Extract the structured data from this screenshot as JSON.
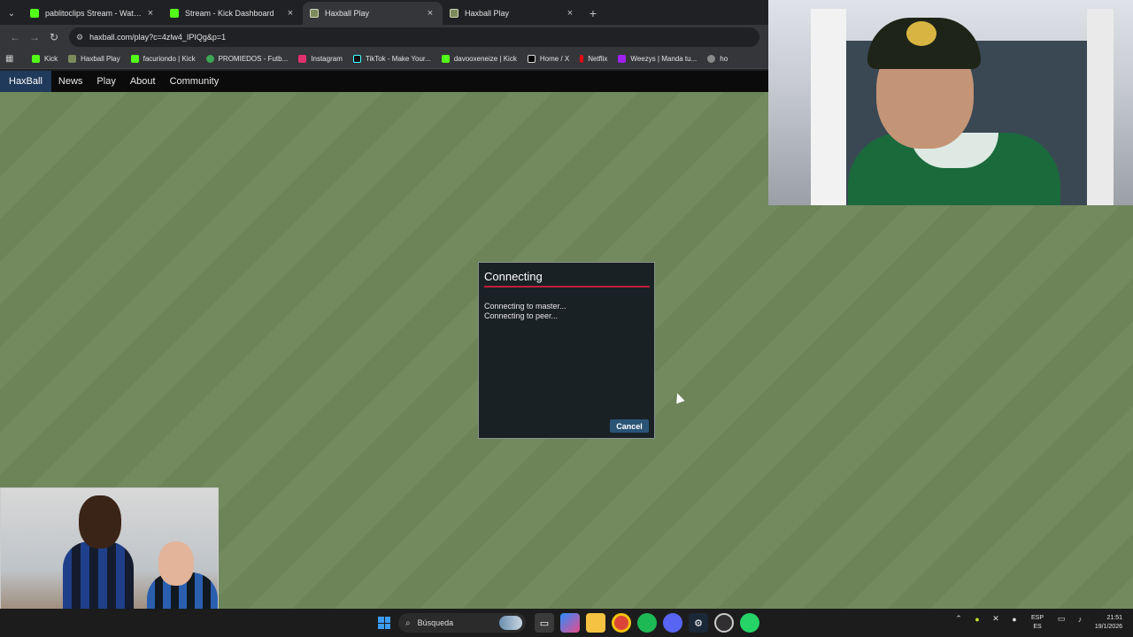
{
  "tabs": [
    {
      "title": "pablitoclips Stream - Watch Li...",
      "icon": "kick-icon",
      "active": false
    },
    {
      "title": "Stream - Kick Dashboard",
      "icon": "kick-icon",
      "active": false
    },
    {
      "title": "Haxball Play",
      "icon": "haxball-icon",
      "active": true
    },
    {
      "title": "Haxball Play",
      "icon": "haxball-icon",
      "active": false
    }
  ],
  "address_bar": {
    "url": "haxball.com/play?c=4zlw4_IPIQg&p=1"
  },
  "bookmarks": [
    {
      "label": "Kick",
      "color": "#53fc18"
    },
    {
      "label": "Haxball Play",
      "color": "#7c8a5c"
    },
    {
      "label": "facuriondo | Kick",
      "color": "#53fc18"
    },
    {
      "label": "PROMIEDOS - Futb...",
      "color": "#3aa655"
    },
    {
      "label": "Instagram",
      "color": "#e1306c"
    },
    {
      "label": "TikTok - Make Your...",
      "color": "#111111"
    },
    {
      "label": "davooxeneize | Kick",
      "color": "#53fc18"
    },
    {
      "label": "Home / X",
      "color": "#000000"
    },
    {
      "label": "Netflix",
      "color": "#e50914"
    },
    {
      "label": "Weezys | Manda tu...",
      "color": "#a020f0"
    },
    {
      "label": "ho",
      "color": "#888888"
    }
  ],
  "site_nav": {
    "logo": "HaxBall",
    "links": [
      "News",
      "Play",
      "About",
      "Community"
    ]
  },
  "dialog": {
    "title": "Connecting",
    "messages": [
      "Connecting to master...",
      "Connecting to peer..."
    ],
    "cancel_label": "Cancel",
    "accent_color": "#c01f3a"
  },
  "taskbar": {
    "search_placeholder": "Búsqueda",
    "language_top": "ESP",
    "language_bottom": "ES",
    "time": "21:51",
    "date": "19/1/2026"
  }
}
